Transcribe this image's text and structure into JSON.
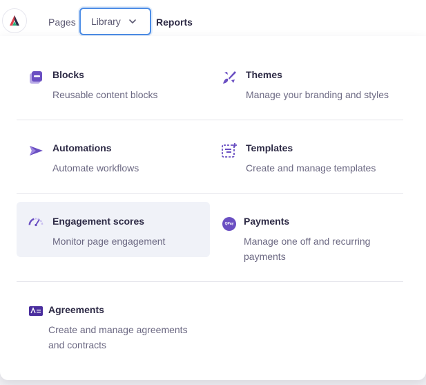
{
  "nav": {
    "pages": "Pages",
    "library": "Library",
    "reports": "Reports"
  },
  "menu": {
    "blocks": {
      "title": "Blocks",
      "desc": "Reusable content blocks",
      "icon": "blocks-icon"
    },
    "themes": {
      "title": "Themes",
      "desc": "Manage your branding and styles",
      "icon": "paintbrush-icon"
    },
    "automations": {
      "title": "Automations",
      "desc": "Automate workflows",
      "icon": "send-icon"
    },
    "templates": {
      "title": "Templates",
      "desc": "Create and manage templates",
      "icon": "template-icon"
    },
    "engagement": {
      "title": "Engagement scores",
      "desc": "Monitor page engagement",
      "icon": "gauge-icon"
    },
    "payments": {
      "title": "Payments",
      "desc": "Manage one off and recurring payments",
      "icon": "qpay-icon",
      "icon_text": "QPay"
    },
    "agreements": {
      "title": "Agreements",
      "desc": "Create and manage agreements and contracts",
      "icon": "agreement-icon"
    }
  },
  "colors": {
    "accent": "#6a4fc2",
    "focus": "#4d8de6",
    "highlight": "#f0f2f8"
  }
}
